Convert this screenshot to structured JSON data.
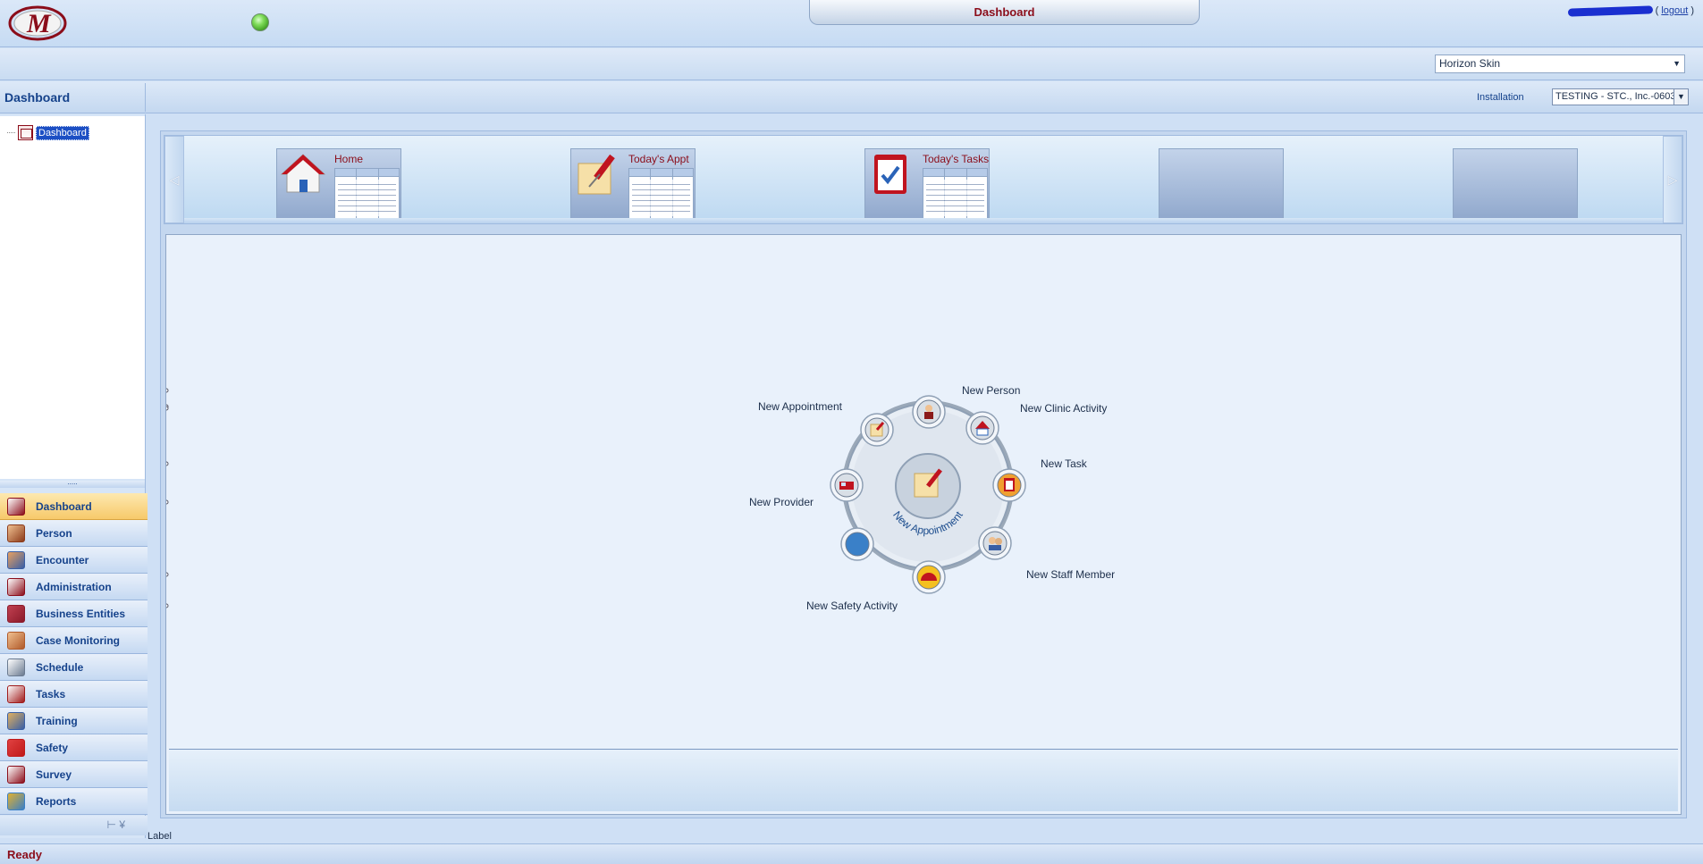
{
  "topbar": {
    "window_title": "Dashboard",
    "logo_letter": "M",
    "logout_prefix": "(",
    "logout_label": "logout",
    "logout_suffix": ")"
  },
  "skin": {
    "selected": "Horizon Skin"
  },
  "header": {
    "nav_title": "Dashboard",
    "installation_label": "Installation",
    "installation_value": "TESTING - STC., Inc.-0603"
  },
  "tree": {
    "root_label": "Dashboard"
  },
  "splitter_dots": ".....",
  "nav": {
    "items": [
      {
        "label": "Dashboard",
        "icon": "dashboard-icon",
        "active": true
      },
      {
        "label": "Person",
        "icon": "person-icon"
      },
      {
        "label": "Encounter",
        "icon": "encounter-icon"
      },
      {
        "label": "Administration",
        "icon": "administration-icon"
      },
      {
        "label": "Business Entities",
        "icon": "briefcase-icon"
      },
      {
        "label": "Case Monitoring",
        "icon": "case-monitoring-icon"
      },
      {
        "label": "Schedule",
        "icon": "calendar-icon"
      },
      {
        "label": "Tasks",
        "icon": "clipboard-check-icon"
      },
      {
        "label": "Training",
        "icon": "training-icon"
      },
      {
        "label": "Safety",
        "icon": "hard-hat-icon"
      },
      {
        "label": "Survey",
        "icon": "survey-icon"
      },
      {
        "label": "Reports",
        "icon": "reports-icon"
      }
    ],
    "footer_glyphs": "⊢ ¥"
  },
  "carousel": {
    "tiles": [
      {
        "label": "Home",
        "icon": "house-icon"
      },
      {
        "label": "Today's Appt",
        "icon": "pushpin-note-icon"
      },
      {
        "label": "Today's Tasks",
        "icon": "clipboard-check-icon"
      },
      {
        "label": "",
        "icon": ""
      },
      {
        "label": "",
        "icon": ""
      }
    ],
    "left_arrow": "◁",
    "right_arrow": "▷"
  },
  "wheel": {
    "center_label": "New Appointment",
    "items": [
      {
        "label": "New Appointment",
        "icon": "pushpin-note-icon"
      },
      {
        "label": "New Person",
        "icon": "person-icon"
      },
      {
        "label": "New Clinic Activity",
        "icon": "clinic-icon"
      },
      {
        "label": "New Task",
        "icon": "clipboard-check-icon"
      },
      {
        "label": "New Staff Member",
        "icon": "staff-icon"
      },
      {
        "label": "New Safety Activity",
        "icon": "hard-hat-icon"
      },
      {
        "label": "",
        "icon": "blank-orb-icon"
      },
      {
        "label": "New Provider",
        "icon": "ambulance-icon"
      }
    ]
  },
  "label_text": "Label",
  "status": {
    "text": "Ready"
  },
  "colors": {
    "accent_red": "#8b0d1a",
    "nav_blue": "#15428b",
    "active_orange": "#f7c96a",
    "panel_blue": "#c4d7ef"
  }
}
